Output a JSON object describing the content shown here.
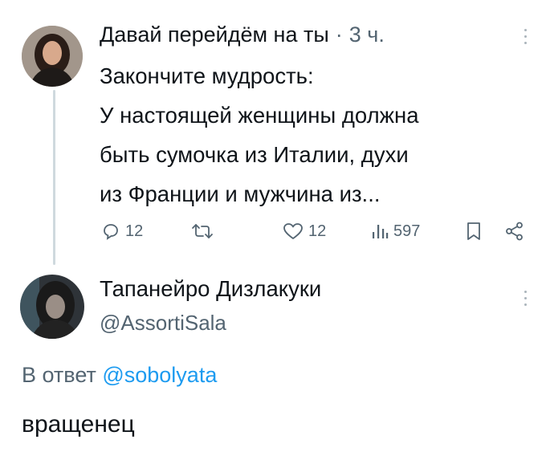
{
  "post": {
    "author_name": "Давай перейдём на ты",
    "separator": "·",
    "time": "3 ч.",
    "text_lines": [
      "Закончите мудрость:",
      "У настоящей женщины должна",
      "быть сумочка из Италии, духи",
      "из Франции и мужчина из..."
    ],
    "actions": {
      "reply_count": "12",
      "like_count": "12",
      "views_count": "597"
    },
    "icons": {
      "more": "more-vertical-icon",
      "reply": "reply-icon",
      "retweet": "retweet-icon",
      "like": "like-icon",
      "views": "views-icon",
      "bookmark": "bookmark-icon",
      "share": "share-icon"
    }
  },
  "reply": {
    "author_name": "Тапанейро Дизлакуки",
    "handle": "@AssortiSala",
    "reply_to_prefix": "В ответ",
    "reply_to_handle": "@sobolyata",
    "text": "вращенец"
  },
  "colors": {
    "text": "#0f1419",
    "muted": "#536471",
    "link": "#1d9bf0",
    "thread_line": "#cfd9de"
  }
}
